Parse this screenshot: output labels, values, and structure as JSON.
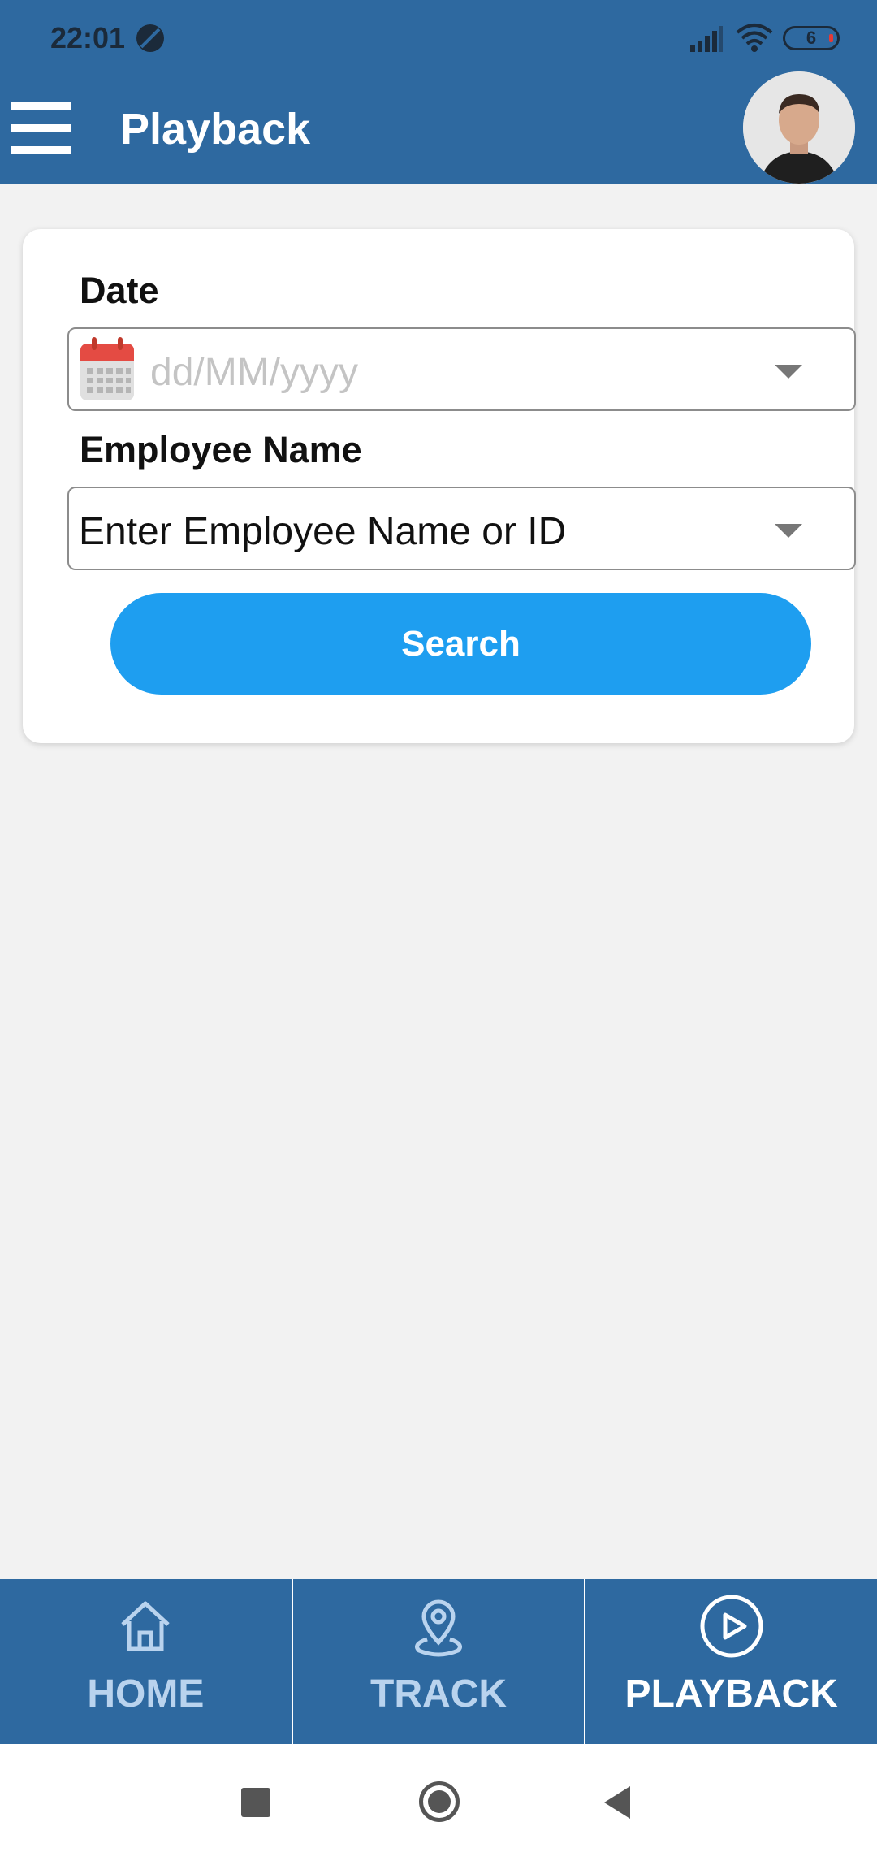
{
  "status_bar": {
    "time": "22:01",
    "battery_level": "6",
    "icons": [
      "signal-icon",
      "wifi-icon",
      "battery-icon"
    ]
  },
  "header": {
    "title": "Playback",
    "background_color": "#2e69a0"
  },
  "form": {
    "date_label": "Date",
    "date_placeholder": "dd/MM/yyyy",
    "employee_label": "Employee Name",
    "employee_value": "Enter Employee Name or ID",
    "search_label": "Search",
    "search_color": "#1e9ef0"
  },
  "bottom_nav": {
    "items": [
      {
        "label": "HOME",
        "icon": "home-icon",
        "active": false
      },
      {
        "label": "TRACK",
        "icon": "location-pin-icon",
        "active": false
      },
      {
        "label": "PLAYBACK",
        "icon": "play-circle-icon",
        "active": true
      }
    ]
  }
}
